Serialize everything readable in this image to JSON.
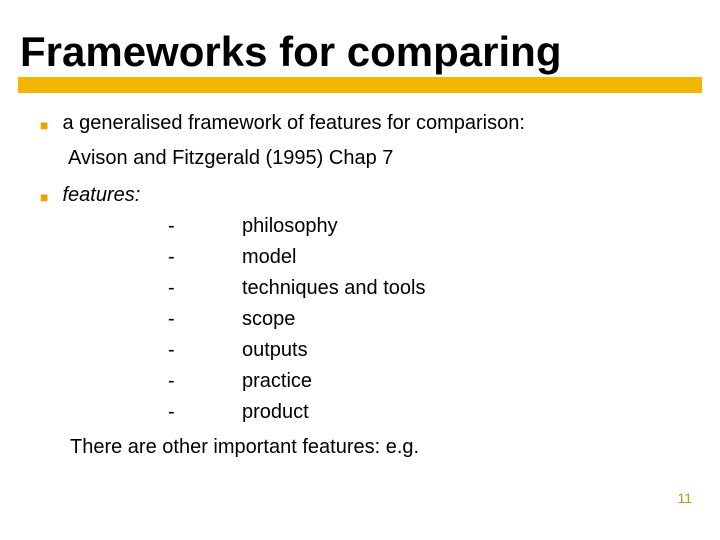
{
  "title": "Frameworks for comparing",
  "bullets": {
    "intro": "a generalised framework of features for comparison:",
    "source": "Avison and Fitzgerald (1995) Chap 7",
    "features_label": "features:"
  },
  "features": {
    "f0": "philosophy",
    "f1": "model",
    "f2": "techniques and tools",
    "f3": "scope",
    "f4": "outputs",
    "f5": "practice",
    "f6": "product"
  },
  "dash": "-",
  "closing": "There are other important features: e.g.",
  "page_number": "11"
}
